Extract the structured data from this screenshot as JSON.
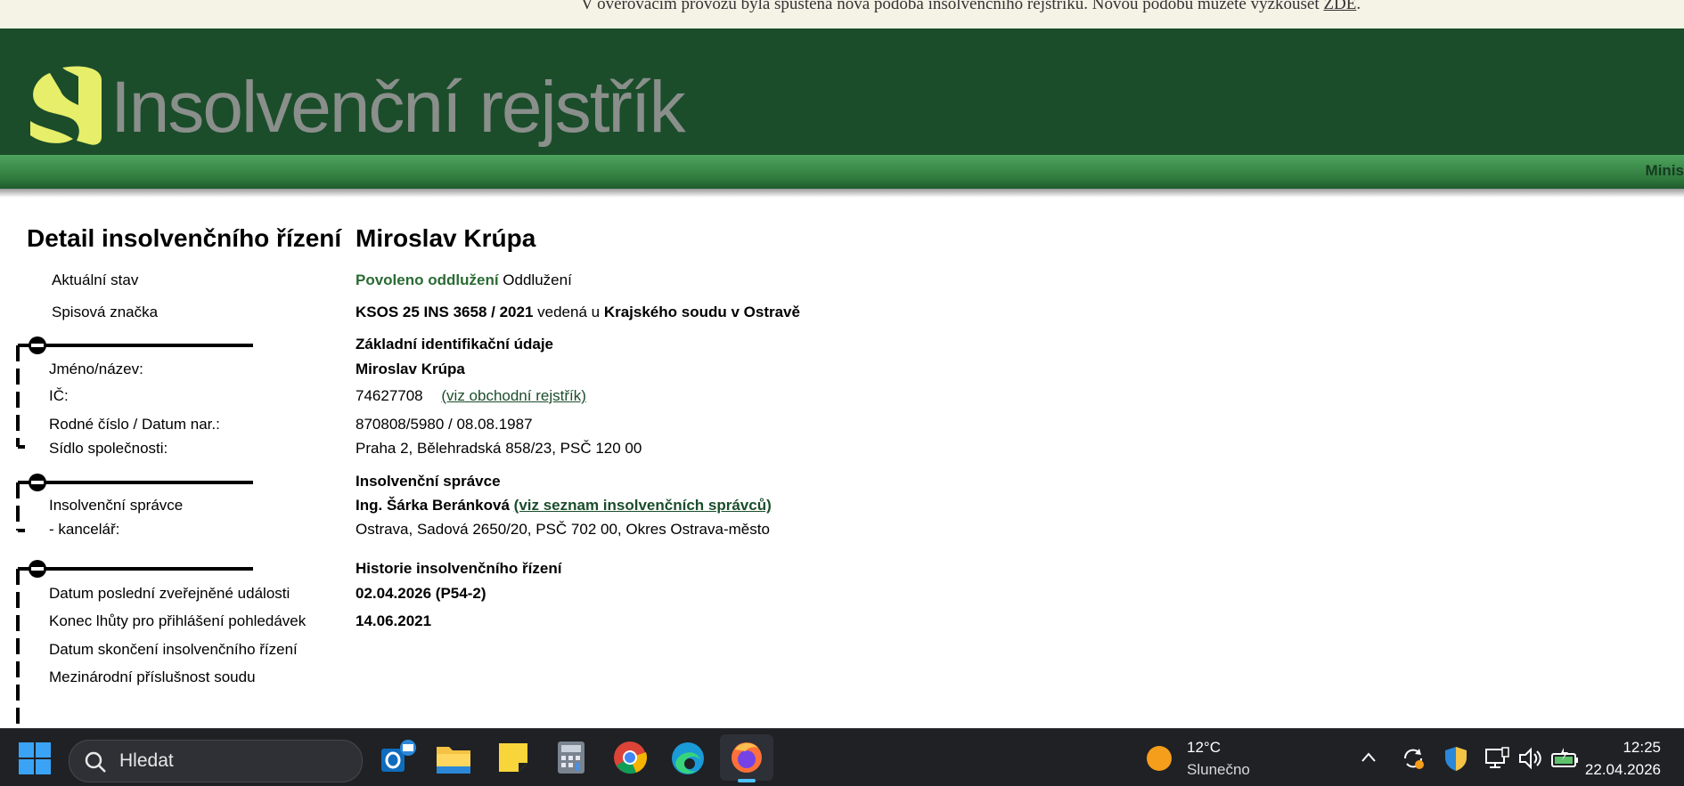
{
  "notice": {
    "text": "V ověřovacím provozu byla spuštěna nová podoba insolvenčního rejstříku. Novou podobu můžete vyzkoušet",
    "link": "ZDE",
    "suffix": "."
  },
  "header": {
    "logo_text": "Insolvenční rejstřík",
    "ministry_label": "Minis"
  },
  "detail": {
    "title": "Detail insolvenčního řízení",
    "name": "Miroslav Krúpa",
    "rows": {
      "stav_label": "Aktuální stav",
      "stav_value_green": "Povoleno oddlužení",
      "stav_value": "Oddlužení",
      "spis_label": "Spisová značka",
      "spis_value": "KSOS 25 INS 3658 / 2021",
      "spis_middle": "vedená u",
      "spis_court": "Krajského soudu v Ostravě"
    },
    "identification": {
      "heading": "Základní identifikační údaje",
      "name_label": "Jméno/název:",
      "name_value": "Miroslav Krúpa",
      "ic_label": "IČ:",
      "ic_value": "74627708",
      "ic_link": "(viz obchodní rejstřík)",
      "rc_label": "Rodné číslo / Datum nar.:",
      "rc_value": "870808/5980 / 08.08.1987",
      "sidlo_label": "Sídlo společnosti:",
      "sidlo_value": "Praha 2, Bělehradská 858/23, PSČ 120 00"
    },
    "spravce": {
      "heading": "Insolvenční správce",
      "label": "Insolvenční správce",
      "value": "Ing. Šárka Beránková",
      "link": "(viz seznam insolvenčních správců)",
      "office_label": "- kancelář:",
      "office_value": "Ostrava, Sadová 2650/20, PSČ 702 00, Okres Ostrava-město"
    },
    "history": {
      "heading": "Historie insolvenčního řízení",
      "last_event_label": "Datum poslední zveřejněné události",
      "last_event_value": "02.04.2026 (P54-2)",
      "deadline_label": "Konec lhůty pro přihlášení pohledávek",
      "deadline_value": "14.06.2021",
      "end_label": "Datum skončení insolvenčního řízení",
      "intl_label": "Mezinárodní příslušnost soudu"
    }
  },
  "taskbar": {
    "search_placeholder": "Hledat",
    "weather_temp": "12°C",
    "weather_desc": "Slunečno",
    "time": "12:25",
    "date": "22.04.2026"
  },
  "colors": {
    "header_bg": "#1b4d2b",
    "logo_yellow": "#e6ee6a",
    "status_green": "#2a6b33"
  }
}
